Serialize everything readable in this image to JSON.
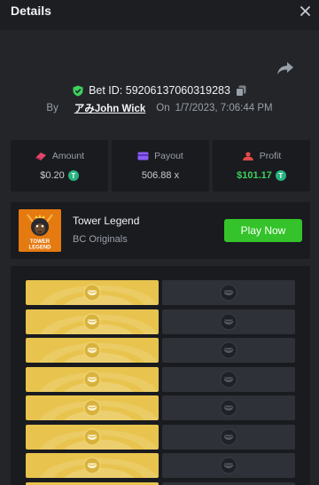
{
  "header": {
    "title": "Details"
  },
  "bet": {
    "id_text": "Bet ID: 59206137060319283",
    "by_label": "By",
    "user": "アみJohn Wick",
    "on_label": "On",
    "datetime": "1/7/2023, 7:06:44 PM"
  },
  "stats": {
    "amount": {
      "label": "Amount",
      "value": "$0.20"
    },
    "payout": {
      "label": "Payout",
      "value": "506.88 x"
    },
    "profit": {
      "label": "Profit",
      "value": "$101.17"
    }
  },
  "currency_glyph": "T",
  "game": {
    "name": "Tower Legend",
    "provider": "BC Originals",
    "play_label": "Play Now",
    "thumb_text_top": "TOWER",
    "thumb_text_bottom": "LEGEND"
  },
  "colors": {
    "gold_tile": "#e8c44e",
    "dark_tile": "#2e3138",
    "play_button": "#34c32a",
    "coin": "#27b380",
    "profit": "#3fd15c"
  },
  "board": {
    "columns": 2,
    "rows_visible": 8,
    "picked_column": [
      "left",
      "left",
      "left",
      "left",
      "left",
      "left",
      "left",
      "left"
    ]
  }
}
